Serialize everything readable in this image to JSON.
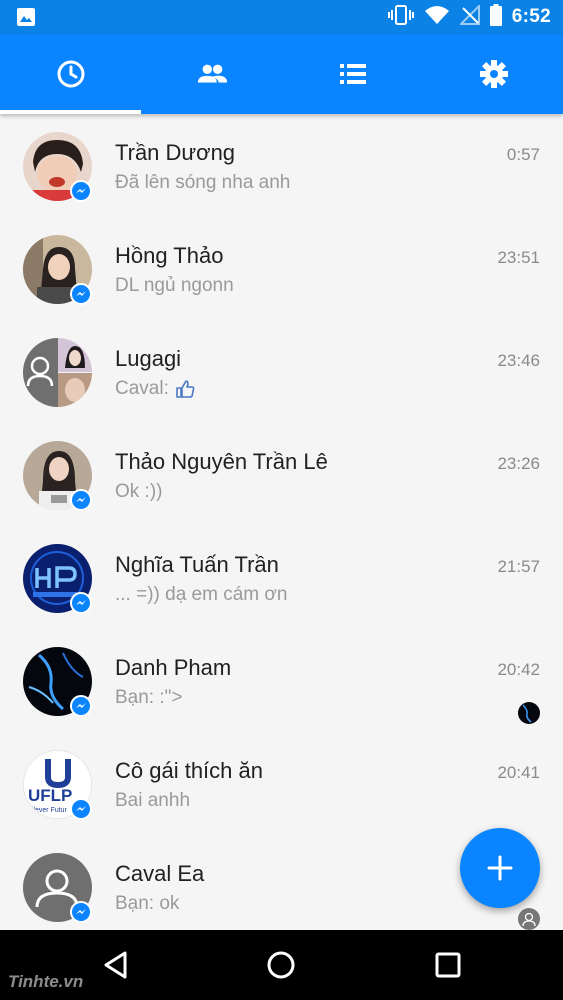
{
  "status_bar": {
    "time": "6:52",
    "icons": [
      "image-icon",
      "vibrate-icon",
      "wifi-icon",
      "no-signal-icon",
      "battery-icon"
    ]
  },
  "tabs": [
    {
      "name": "recent",
      "icon": "clock-icon",
      "selected": true
    },
    {
      "name": "people",
      "icon": "people-icon",
      "selected": false
    },
    {
      "name": "groups",
      "icon": "list-icon",
      "selected": false
    },
    {
      "name": "settings",
      "icon": "gear-icon",
      "selected": false
    }
  ],
  "conversations": [
    {
      "name": "Trần Dương",
      "preview": "Đã lên sóng nha anh",
      "time": "0:57"
    },
    {
      "name": "Hồng Thảo",
      "preview": "DL ngủ ngonn",
      "time": "23:51"
    },
    {
      "name": "Lugagi",
      "preview": "Caval:",
      "time": "23:46",
      "preview_icon": "thumbs-up-icon"
    },
    {
      "name": "Thảo Nguyên Trần Lê",
      "preview": "Ok :))",
      "time": "23:26"
    },
    {
      "name": "Nghĩa Tuấn Trần",
      "preview": "... =)) dạ em cám ơn",
      "time": "21:57"
    },
    {
      "name": "Danh Pham",
      "preview": "Bạn: :\">",
      "time": "20:42"
    },
    {
      "name": "Cô gái thích ăn",
      "preview": "Bai anhh",
      "time": "20:41"
    },
    {
      "name": "Caval Ea",
      "preview": "Bạn: ok",
      "time": ""
    }
  ],
  "avatars": {
    "uflp_text": "UFLP",
    "uflp_sub": "nilever Futur"
  },
  "fab_icon": "plus-icon",
  "nav": [
    "back-icon",
    "home-icon",
    "recents-icon"
  ],
  "watermark": "Tinhte.vn",
  "colors": {
    "primary": "#0b84ff",
    "status": "#0a82e6",
    "name": "#212121",
    "preview": "#9a9a9a"
  }
}
